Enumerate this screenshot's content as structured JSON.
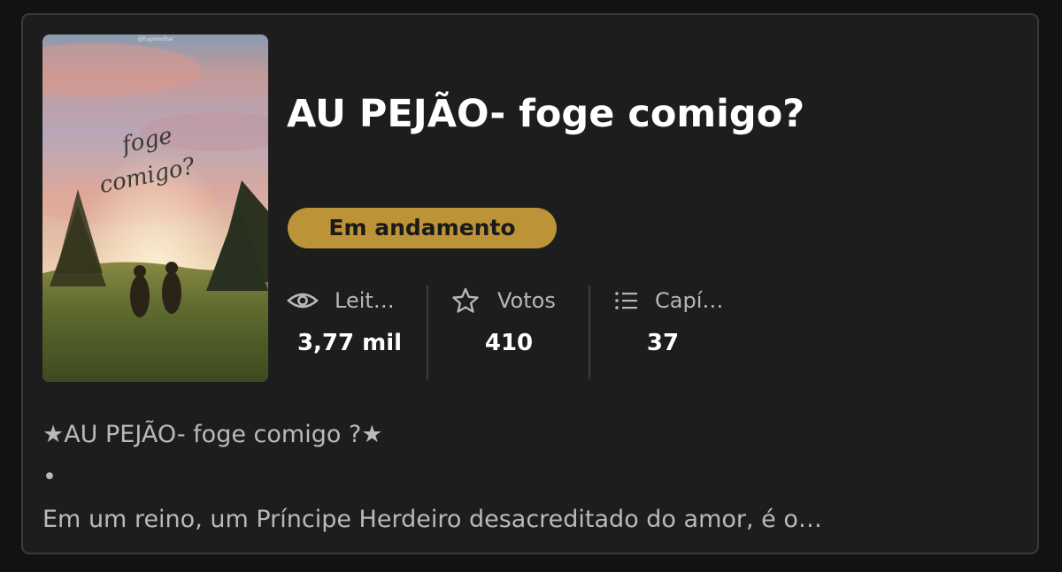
{
  "story": {
    "title": "AU PEJÃO- foge comigo?",
    "status": "Em andamento",
    "cover": {
      "script_text": "foge comigo?",
      "watermark": "@fugomolhar"
    }
  },
  "stats": [
    {
      "icon": "eye-icon",
      "label": "Leit…",
      "value": "3,77 mil"
    },
    {
      "icon": "star-icon",
      "label": "Votos",
      "value": "410"
    },
    {
      "icon": "list-icon",
      "label": "Capí…",
      "value": "37"
    }
  ],
  "description": {
    "line1": "★AU PEJÃO- foge comigo ?★",
    "line2": "•",
    "line3": "Em um reino, um Príncipe Herdeiro desacreditado do amor, é o…"
  },
  "colors": {
    "card_bg": "#1d1d1d",
    "badge": "#bd9338",
    "title": "#ffffff",
    "muted": "#b7b7b7"
  }
}
